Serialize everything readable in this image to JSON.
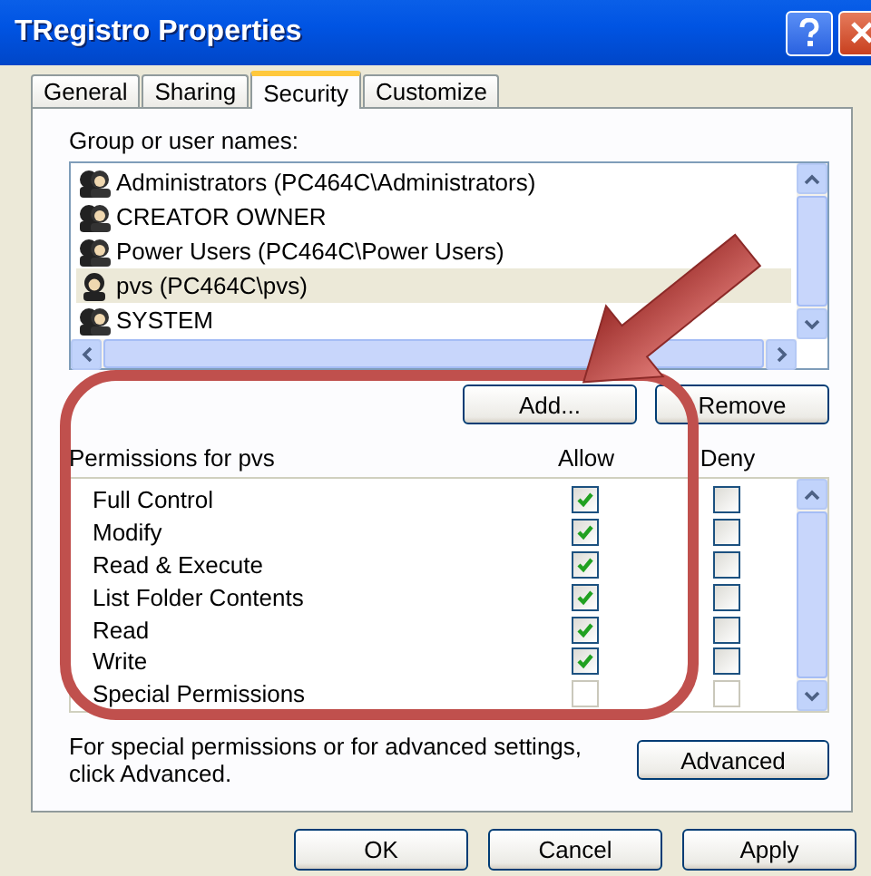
{
  "window": {
    "title": "TRegistro Properties"
  },
  "tabs": [
    {
      "label": "General",
      "selected": false
    },
    {
      "label": "Sharing",
      "selected": false
    },
    {
      "label": "Security",
      "selected": true
    },
    {
      "label": "Customize",
      "selected": false
    }
  ],
  "users": {
    "label": "Group or user names:",
    "items": [
      {
        "name": "Administrators (PC464C\\Administrators)",
        "kind": "group",
        "selected": false
      },
      {
        "name": "CREATOR OWNER",
        "kind": "group",
        "selected": false
      },
      {
        "name": "Power Users (PC464C\\Power Users)",
        "kind": "group",
        "selected": false
      },
      {
        "name": "pvs (PC464C\\pvs)",
        "kind": "user",
        "selected": true
      },
      {
        "name": "SYSTEM",
        "kind": "group",
        "selected": false
      }
    ],
    "buttons": [
      "Add...",
      "Remove"
    ]
  },
  "permissions": {
    "label": "Permissions for pvs",
    "columns": [
      "Allow",
      "Deny"
    ],
    "rows": [
      {
        "name": "Full Control",
        "allow": true,
        "deny": false,
        "disabled": false
      },
      {
        "name": "Modify",
        "allow": true,
        "deny": false,
        "disabled": false
      },
      {
        "name": "Read & Execute",
        "allow": true,
        "deny": false,
        "disabled": false
      },
      {
        "name": "List Folder Contents",
        "allow": true,
        "deny": false,
        "disabled": false
      },
      {
        "name": "Read",
        "allow": true,
        "deny": false,
        "disabled": false
      },
      {
        "name": "Write",
        "allow": true,
        "deny": false,
        "disabled": false
      },
      {
        "name": "Special Permissions",
        "allow": false,
        "deny": false,
        "disabled": true
      }
    ]
  },
  "advanced": {
    "text": "For special permissions or for advanced settings, click Advanced.",
    "button": "Advanced"
  },
  "buttons": [
    "OK",
    "Cancel",
    "Apply"
  ]
}
